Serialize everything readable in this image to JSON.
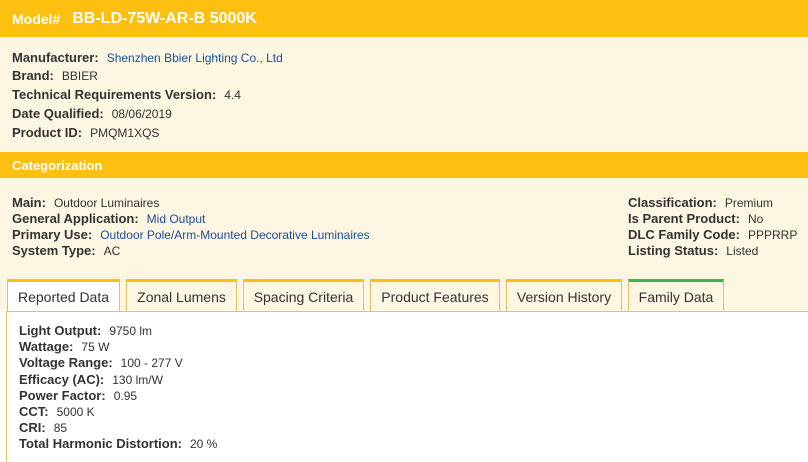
{
  "header": {
    "model_label": "Model#",
    "model_value": "BB-LD-75W-AR-B 5000K"
  },
  "info": [
    {
      "label": "Manufacturer:",
      "value": "Shenzhen Bbier Lighting Co., Ltd",
      "link": true
    },
    {
      "label": "Brand:",
      "value": "BBIER",
      "link": false
    },
    {
      "label": "Technical Requirements Version:",
      "value": "4.4",
      "link": false
    },
    {
      "label": "Date Qualified:",
      "value": "08/06/2019",
      "link": false
    },
    {
      "label": "Product ID:",
      "value": "PMQM1XQS",
      "link": false
    }
  ],
  "categorization": {
    "title": "Categorization",
    "left": [
      {
        "label": "Main:",
        "value": "Outdoor Luminaires"
      },
      {
        "label": "General Application:",
        "value": "Mid Output"
      },
      {
        "label": "Primary Use:",
        "value": "Outdoor Pole/Arm-Mounted Decorative Luminaires"
      },
      {
        "label": "System Type:",
        "value": "AC"
      }
    ],
    "right": [
      {
        "label": "Classification:",
        "value": "Premium"
      },
      {
        "label": "Is Parent Product:",
        "value": "No"
      },
      {
        "label": "DLC Family Code:",
        "value": "PPPRRP"
      },
      {
        "label": "Listing Status:",
        "value": "Listed"
      }
    ]
  },
  "tabs": [
    {
      "label": "Reported Data",
      "active": true
    },
    {
      "label": "Zonal Lumens",
      "active": false
    },
    {
      "label": "Spacing Criteria",
      "active": false
    },
    {
      "label": "Product Features",
      "active": false
    },
    {
      "label": "Version History",
      "active": false
    },
    {
      "label": "Family Data",
      "active": false
    }
  ],
  "reported": [
    {
      "label": "Light Output:",
      "value": "9750 lm"
    },
    {
      "label": "Wattage:",
      "value": "75 W"
    },
    {
      "label": "Voltage Range:",
      "value": "100 - 277 V"
    },
    {
      "label": "Efficacy (AC):",
      "value": "130 lm/W"
    },
    {
      "label": "Power Factor:",
      "value": "0.95"
    },
    {
      "label": "CCT:",
      "value": "5000 K"
    },
    {
      "label": "CRI:",
      "value": "85"
    },
    {
      "label": "Total Harmonic Distortion:",
      "value": "20 %"
    }
  ],
  "colors": {
    "accent": "#fdc010",
    "panel": "#fdf6e3",
    "link": "#1a4f9c",
    "family_tab": "#3bb54a"
  }
}
